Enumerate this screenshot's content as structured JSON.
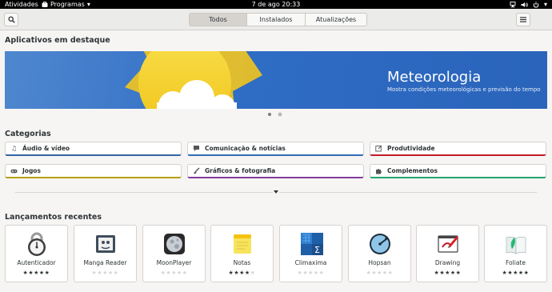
{
  "topbar": {
    "activities": "Atividades",
    "app_menu": "Programas",
    "clock": "7 de ago  20:33"
  },
  "header": {
    "tabs": [
      {
        "label": "Todos",
        "selected": true
      },
      {
        "label": "Instalados",
        "selected": false
      },
      {
        "label": "Atualizações",
        "selected": false
      }
    ],
    "search_icon": "search-icon",
    "menu_icon": "hamburger-menu-icon"
  },
  "featured": {
    "heading": "Aplicativos em destaque",
    "title": "Meteorologia",
    "subtitle": "Mostra condições meteorológicas e previsão do tempo",
    "page_count": 2,
    "active_page": 1
  },
  "categories": {
    "heading": "Categorias",
    "items": [
      {
        "label": "Áudio & vídeo",
        "icon": "music-note-icon",
        "color": "#3465a4"
      },
      {
        "label": "Comunicação & notícias",
        "icon": "chat-icon",
        "color": "#2e6db3"
      },
      {
        "label": "Produtividade",
        "icon": "edit-icon",
        "color": "#c01c28"
      },
      {
        "label": "Jogos",
        "icon": "gamepad-icon",
        "color": "#b5a000"
      },
      {
        "label": "Gráficos & fotografia",
        "icon": "brush-icon",
        "color": "#813d9c"
      },
      {
        "label": "Complementos",
        "icon": "puzzle-icon",
        "color": "#26a269"
      }
    ]
  },
  "recent": {
    "heading": "Lançamentos recentes",
    "apps": [
      {
        "name": "Autenticador",
        "stars": 5
      },
      {
        "name": "Manga Reader",
        "stars": 0
      },
      {
        "name": "MoonPlayer",
        "stars": 0
      },
      {
        "name": "Notas",
        "stars": 4
      },
      {
        "name": "Climaxima",
        "stars": 0
      },
      {
        "name": "Hopsan",
        "stars": 0
      },
      {
        "name": "Drawing",
        "stars": 5
      },
      {
        "name": "Foliate",
        "stars": 5
      }
    ]
  },
  "colors": {
    "banner": "#2f6cc4",
    "sun": "#f5d02e",
    "accent": "#3584e4"
  }
}
